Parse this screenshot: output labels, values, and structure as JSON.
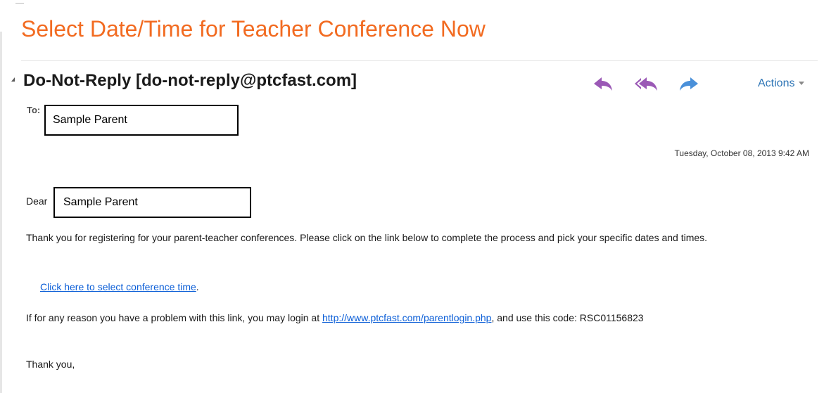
{
  "email": {
    "subject": "Select Date/Time for Teacher Conference Now",
    "sender": "Do-Not-Reply [do-not-reply@ptcfast.com]",
    "to_label": "To:",
    "recipient": "Sample Parent",
    "sent_date": "Tuesday, October 08, 2013 9:42 AM"
  },
  "toolbar": {
    "reply_icon": "reply-icon",
    "reply_all_icon": "reply-all-icon",
    "forward_icon": "forward-icon",
    "actions_label": "Actions",
    "colors": {
      "reply": "#9b59b6",
      "forward": "#4a90d9",
      "actions": "#2e75b6"
    }
  },
  "body": {
    "dear_label": "Dear",
    "salutation_name": "Sample Parent",
    "paragraph1": "Thank you for registering for your parent-teacher conferences. Please click on the link below to complete the process and pick your specific dates and times.",
    "link_text": "Click here to select conference time",
    "link_suffix": ".",
    "paragraph2_before": "If for any reason you have a problem with this link, you may login at ",
    "paragraph2_link": "http://www.ptcfast.com/parentlogin.php",
    "paragraph2_after": ", and use this code: RSC01156823",
    "closing": "Thank you,"
  },
  "colors": {
    "subject": "#f26b21",
    "link": "#0b5ed7"
  }
}
